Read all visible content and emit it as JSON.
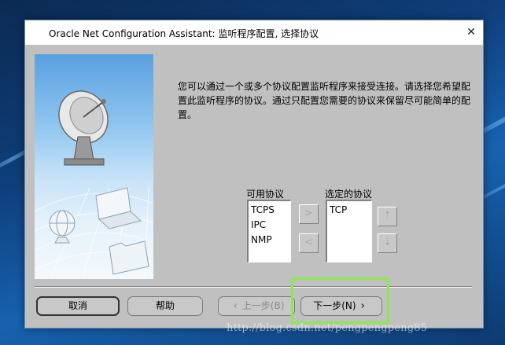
{
  "window": {
    "title": "Oracle Net Configuration Assistant: 监听程序配置, 选择协议",
    "close_glyph": "✕"
  },
  "intro_text": "您可以通过一个或多个协议配置监听程序来接受连接。请选择您希望配置此监听程序的协议。通过只配置您需要的协议来保留尽可能简单的配置。",
  "available_protocols": {
    "label": "可用协议",
    "items": [
      "TCPS",
      "IPC",
      "NMP"
    ]
  },
  "selected_protocols": {
    "label": "选定的协议",
    "items": [
      "TCP"
    ]
  },
  "buttons": {
    "cancel": "取消",
    "help": "帮助",
    "back": "上一步(B)",
    "next": "下一步(N)"
  },
  "watermark": "http://blog.csdn.net/pengpengpeng85",
  "colors": {
    "dialog_bg": "#c0c0c0",
    "highlight_box": "#8bea52"
  }
}
